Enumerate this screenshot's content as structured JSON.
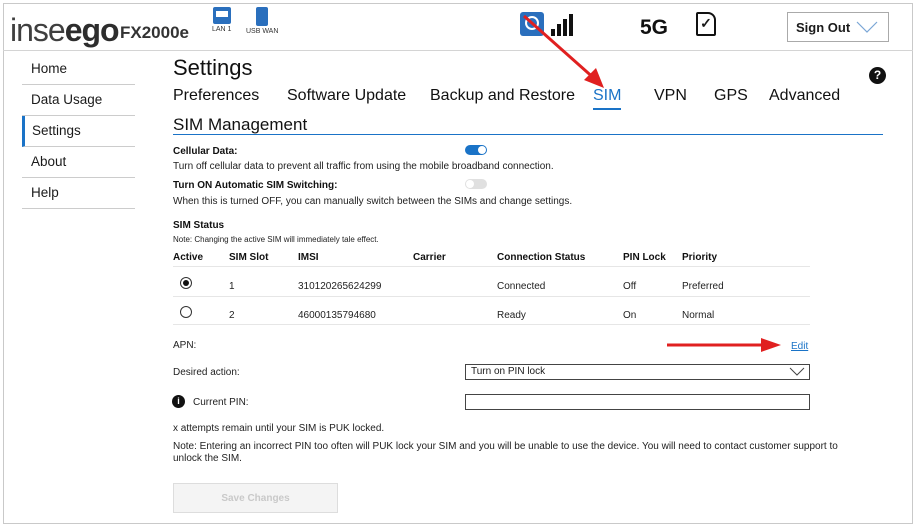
{
  "brand": {
    "logo_text_a": "inse",
    "logo_text_b": "go",
    "model": "FX2000e"
  },
  "header": {
    "ports": [
      {
        "label": "LAN 1"
      },
      {
        "label": "USB WAN"
      }
    ],
    "network_type": "5G",
    "sign_out_label": "Sign Out"
  },
  "sidebar": {
    "items": [
      {
        "label": "Home"
      },
      {
        "label": "Data Usage"
      },
      {
        "label": "Settings"
      },
      {
        "label": "About"
      },
      {
        "label": "Help"
      }
    ]
  },
  "page": {
    "title": "Settings",
    "help_icon": "?"
  },
  "tabs": [
    {
      "label": "Preferences"
    },
    {
      "label": "Software Update"
    },
    {
      "label": "Backup and Restore"
    },
    {
      "label": "SIM"
    },
    {
      "label": "VPN"
    },
    {
      "label": "GPS"
    },
    {
      "label": "Advanced"
    }
  ],
  "section": {
    "title": "SIM Management"
  },
  "cellular": {
    "label": "Cellular Data:",
    "desc": "Turn off cellular data to prevent all traffic from using the mobile broadband connection.",
    "enabled": true
  },
  "auto_switch": {
    "label": "Turn ON Automatic SIM Switching:",
    "desc": "When this is turned OFF, you can manually switch between the SIMs and change settings.",
    "enabled": false
  },
  "sim_status": {
    "title": "SIM Status",
    "note": "Note: Changing the active SIM will immediately tale effect.",
    "columns": [
      "Active",
      "SIM Slot",
      "IMSI",
      "Carrier",
      "Connection Status",
      "PIN Lock",
      "Priority"
    ],
    "rows": [
      {
        "active": true,
        "slot": "1",
        "imsi": "310120265624299",
        "carrier": "",
        "status": "Connected",
        "pin_lock": "Off",
        "priority": "Preferred"
      },
      {
        "active": false,
        "slot": "2",
        "imsi": "46000135794680",
        "carrier": "",
        "status": "Ready",
        "pin_lock": "On",
        "priority": "Normal"
      }
    ]
  },
  "apn": {
    "label": "APN:",
    "edit_label": "Edit"
  },
  "desired_action": {
    "label": "Desired action:",
    "value": "Turn on PIN lock"
  },
  "current_pin": {
    "label": "Current PIN:",
    "value": ""
  },
  "attempts_text": "x attempts remain until your SIM is PUK locked.",
  "warning_text": "Note: Entering an incorrect PIN too often will PUK lock your SIM and you will be unable to use the device. You will need to contact  customer support to unlock the SIM.",
  "save_label": "Save Changes",
  "colors": {
    "accent": "#1a73c7",
    "annotation_arrow": "#e02020"
  },
  "icons": [
    "lan-icon",
    "usb-icon",
    "network-status-icon",
    "signal-bars-icon",
    "sim-card-icon",
    "chevron-down-icon",
    "help-icon",
    "info-icon"
  ]
}
